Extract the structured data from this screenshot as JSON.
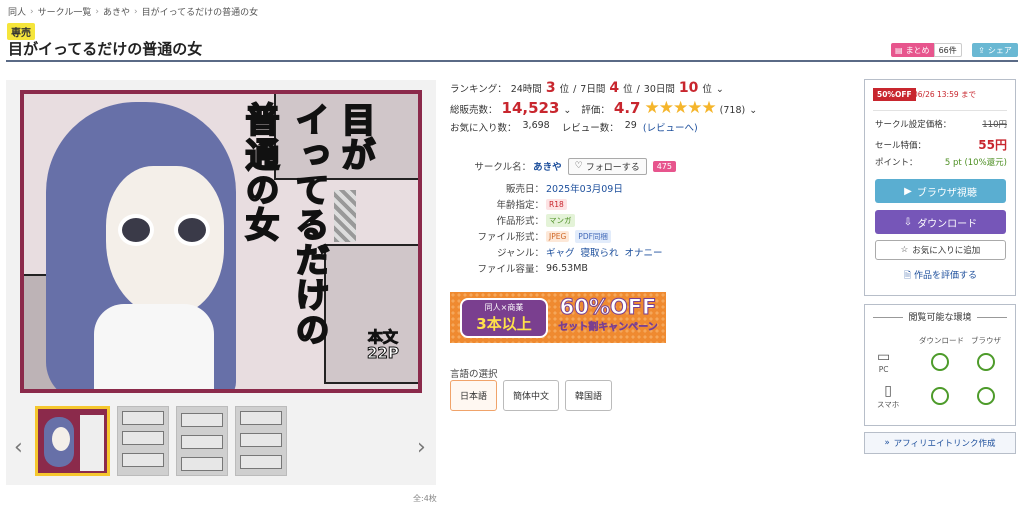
{
  "breadcrumb": [
    "同人",
    "サークル一覧",
    "あきや",
    "目がイってるだけの普通の女"
  ],
  "exclusive_badge": "専売",
  "title": "目がイってるだけの普通の女",
  "header": {
    "matome_label": "まとめ",
    "matome_count": "66件",
    "share_label": "シェア"
  },
  "cover": {
    "title_col1": "目が",
    "title_col2": "イってるだけの",
    "title_col3": "普通の女",
    "pages_line1": "本文",
    "pages_line2": "22P"
  },
  "gallery": {
    "total": "全:4枚"
  },
  "ranking": {
    "label": "ランキング：",
    "d24_label": "24時間",
    "d24_value": "3",
    "unit": "位",
    "d7_label": "7日間",
    "d7_value": "4",
    "d30_label": "30日間",
    "d30_value": "10"
  },
  "sales": {
    "label": "総販売数：",
    "value": "14,523",
    "rating_label": "評価：",
    "rating_value": "4.7",
    "rating_stars": "★★★★★",
    "rating_count": "(718)"
  },
  "favorites": {
    "label": "お気に入り数：",
    "value": "3,698",
    "review_label": "レビュー数：",
    "review_value": "29",
    "review_link": "(レビューへ)"
  },
  "spec": {
    "circle_label": "サークル名：",
    "circle_value": "あきや",
    "follow_label": "フォローする",
    "follow_count": "475",
    "date_label": "販売日：",
    "date_value": "2025年03月09日",
    "age_label": "年齢指定：",
    "age_value": "R18",
    "format_label": "作品形式：",
    "format_value": "マンガ",
    "file_label": "ファイル形式：",
    "file_jpeg": "JPEG",
    "file_pdf": "PDF同梱",
    "genre_label": "ジャンル：",
    "genres": [
      "ギャグ",
      "寝取られ",
      "オナニー"
    ],
    "size_label": "ファイル容量：",
    "size_value": "96.53MB"
  },
  "banner": {
    "line1": "同人×商業",
    "line2": "3本以上",
    "line3": "60%OFF",
    "line4": "セット割キャンペーン"
  },
  "language": {
    "label": "言語の選択",
    "options": [
      "日本語",
      "簡体中文",
      "韓国語"
    ]
  },
  "purchase": {
    "sale_badge": "50%OFF",
    "sale_until": "06/26 13:59 まで",
    "list_price_label": "サークル設定価格：",
    "list_price": "110円",
    "sale_price_label": "セール特価：",
    "sale_price": "55円",
    "points_label": "ポイント：",
    "points_value": "5 pt (10%還元)",
    "browser_btn": "ブラウザ視聴",
    "download_btn": "ダウンロード",
    "fav_btn": "お気に入りに追加",
    "rate_btn": "作品を評価する"
  },
  "environment": {
    "title": "閲覧可能な環境",
    "col_download": "ダウンロード",
    "col_browser": "ブラウザ",
    "row_pc": "PC",
    "row_phone": "スマホ"
  },
  "affiliate_label": "アフィリエイトリンク作成",
  "colors": {
    "accent_red": "#c8262e",
    "browser_blue": "#5aaed1",
    "download_purple": "#7656b8",
    "link_blue": "#1d4f9c"
  }
}
